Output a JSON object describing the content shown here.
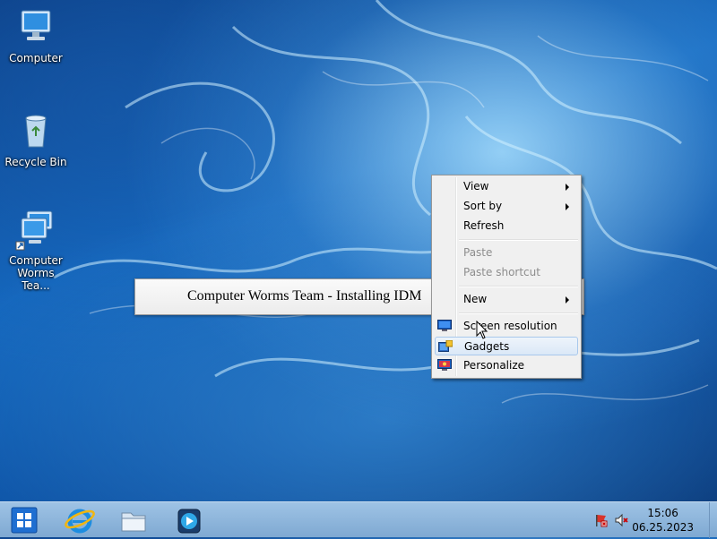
{
  "desktop": {
    "icons": [
      {
        "label": "Computer"
      },
      {
        "label": "Recycle Bin"
      },
      {
        "label_line1": "Computer",
        "label_line2": "Worms Tea..."
      }
    ]
  },
  "background_window": {
    "title": "Computer Worms Team - Installing IDM"
  },
  "context_menu": {
    "items": [
      {
        "label": "View",
        "submenu": true
      },
      {
        "label": "Sort by",
        "submenu": true
      },
      {
        "label": "Refresh"
      },
      {
        "label": "Paste",
        "disabled": true
      },
      {
        "label": "Paste shortcut",
        "disabled": true
      },
      {
        "label": "New",
        "submenu": true
      },
      {
        "label": "Screen resolution",
        "icon": "display-icon"
      },
      {
        "label": "Gadgets",
        "icon": "gadgets-icon",
        "highlighted": true
      },
      {
        "label": "Personalize",
        "icon": "personalize-icon"
      }
    ]
  },
  "taskbar": {
    "pinned": [
      {
        "icon": "start-windows-icon"
      },
      {
        "icon": "internet-explorer-icon"
      },
      {
        "icon": "file-explorer-icon"
      },
      {
        "icon": "media-player-icon"
      }
    ],
    "tray": {
      "icons": [
        "action-center-flag-icon",
        "volume-muted-icon"
      ],
      "time": "15:06",
      "date": "06.25.2023"
    }
  },
  "colors": {
    "accent": "#1468bf",
    "taskbar": "#8db6de",
    "menu_bg": "#f0f0f0",
    "highlight": "#dbe8f7"
  }
}
